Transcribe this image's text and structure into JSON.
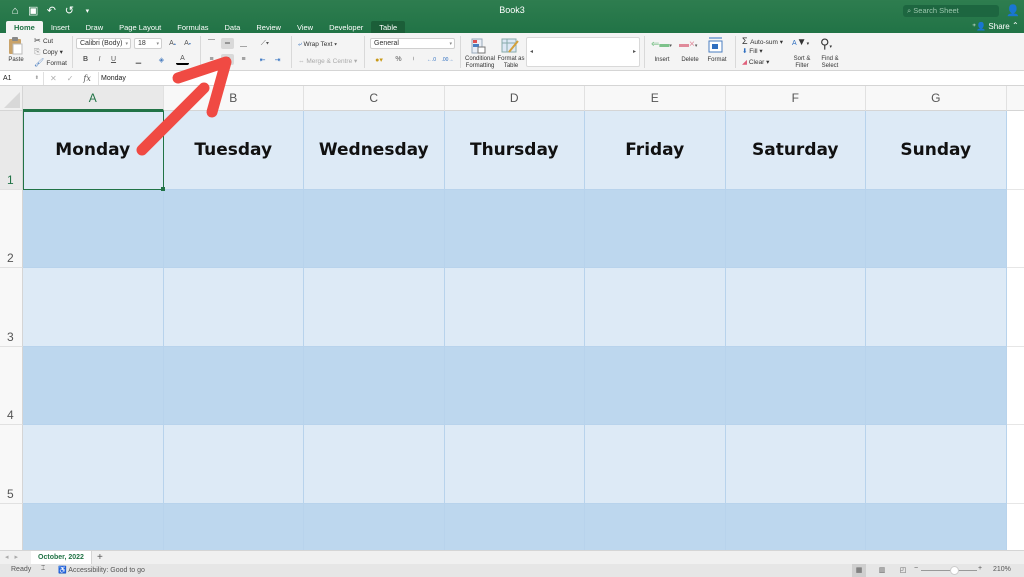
{
  "titlebar": {
    "doc_title": "Book3",
    "search_placeholder": "Search Sheet",
    "share_label": "Share",
    "qat": {
      "home": "⌂",
      "save": "▣",
      "undo": "↶",
      "redo": "↺",
      "more": "▾"
    }
  },
  "tabs": [
    "Home",
    "Insert",
    "Draw",
    "Page Layout",
    "Formulas",
    "Data",
    "Review",
    "View",
    "Developer",
    "Table"
  ],
  "ribbon": {
    "paste": "Paste",
    "cut": "Cut",
    "copy": "Copy",
    "format_painter": "Format",
    "font_name": "Calibri (Body)",
    "font_size": "18",
    "bold": "B",
    "italic": "I",
    "underline": "U",
    "wrap_text": "Wrap Text",
    "merge_centre": "Merge & Centre",
    "number_format": "General",
    "percent": "%",
    "comma": "⁾",
    "conditional_formatting": "Conditional Formatting",
    "format_as_table": "Format as Table",
    "insert": "Insert",
    "delete": "Delete",
    "format": "Format",
    "autosum": "Auto-sum",
    "fill": "Fill",
    "clear": "Clear",
    "sort_filter": "Sort & Filter",
    "find_select": "Find & Select"
  },
  "formula_bar": {
    "name_box": "A1",
    "cancel": "✕",
    "enter": "✓",
    "fx": "fx",
    "value": "Monday"
  },
  "grid": {
    "columns": [
      "A",
      "B",
      "C",
      "D",
      "E",
      "F",
      "G"
    ],
    "rows": [
      "1",
      "2",
      "3",
      "4",
      "5"
    ],
    "header_row": [
      "Monday",
      "Tuesday",
      "Wednesday",
      "Thursday",
      "Friday",
      "Saturday",
      "Sunday"
    ],
    "selected_cell": "A1"
  },
  "sheets": {
    "active": "October, 2022",
    "add": "+"
  },
  "status": {
    "ready": "Ready",
    "accessibility": "Accessibility: Good to go",
    "zoom": "210%",
    "zoom_minus": "−",
    "zoom_plus": "+"
  },
  "colors": {
    "brand": "#217346",
    "row_light": "#ddeaf6",
    "row_dark": "#bdd7ee",
    "annotation_arrow": "#f04a43"
  }
}
